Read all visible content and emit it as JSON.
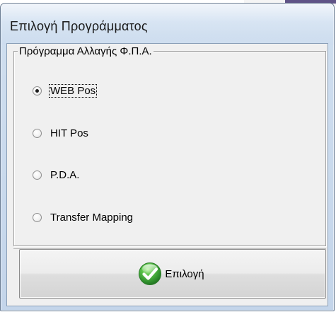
{
  "dialog": {
    "title": "Επιλογή Προγράμματος"
  },
  "group": {
    "legend": "Πρόγραμμα Αλλαγής Φ.Π.Α.",
    "options": [
      {
        "label": "WEB Pos",
        "checked": true
      },
      {
        "label": "HIT Pos",
        "checked": false
      },
      {
        "label": "P.D.A.",
        "checked": false
      },
      {
        "label": "Transfer Mapping",
        "checked": false
      }
    ],
    "selected": "WEB Pos"
  },
  "actions": {
    "select_label": "Επιλογή",
    "select_icon": "green-checkmark-icon"
  },
  "colors": {
    "title_gradient_top": "#dfe9f5",
    "client_bg": "#f0f0f0",
    "check_green": "#3fa33f"
  }
}
